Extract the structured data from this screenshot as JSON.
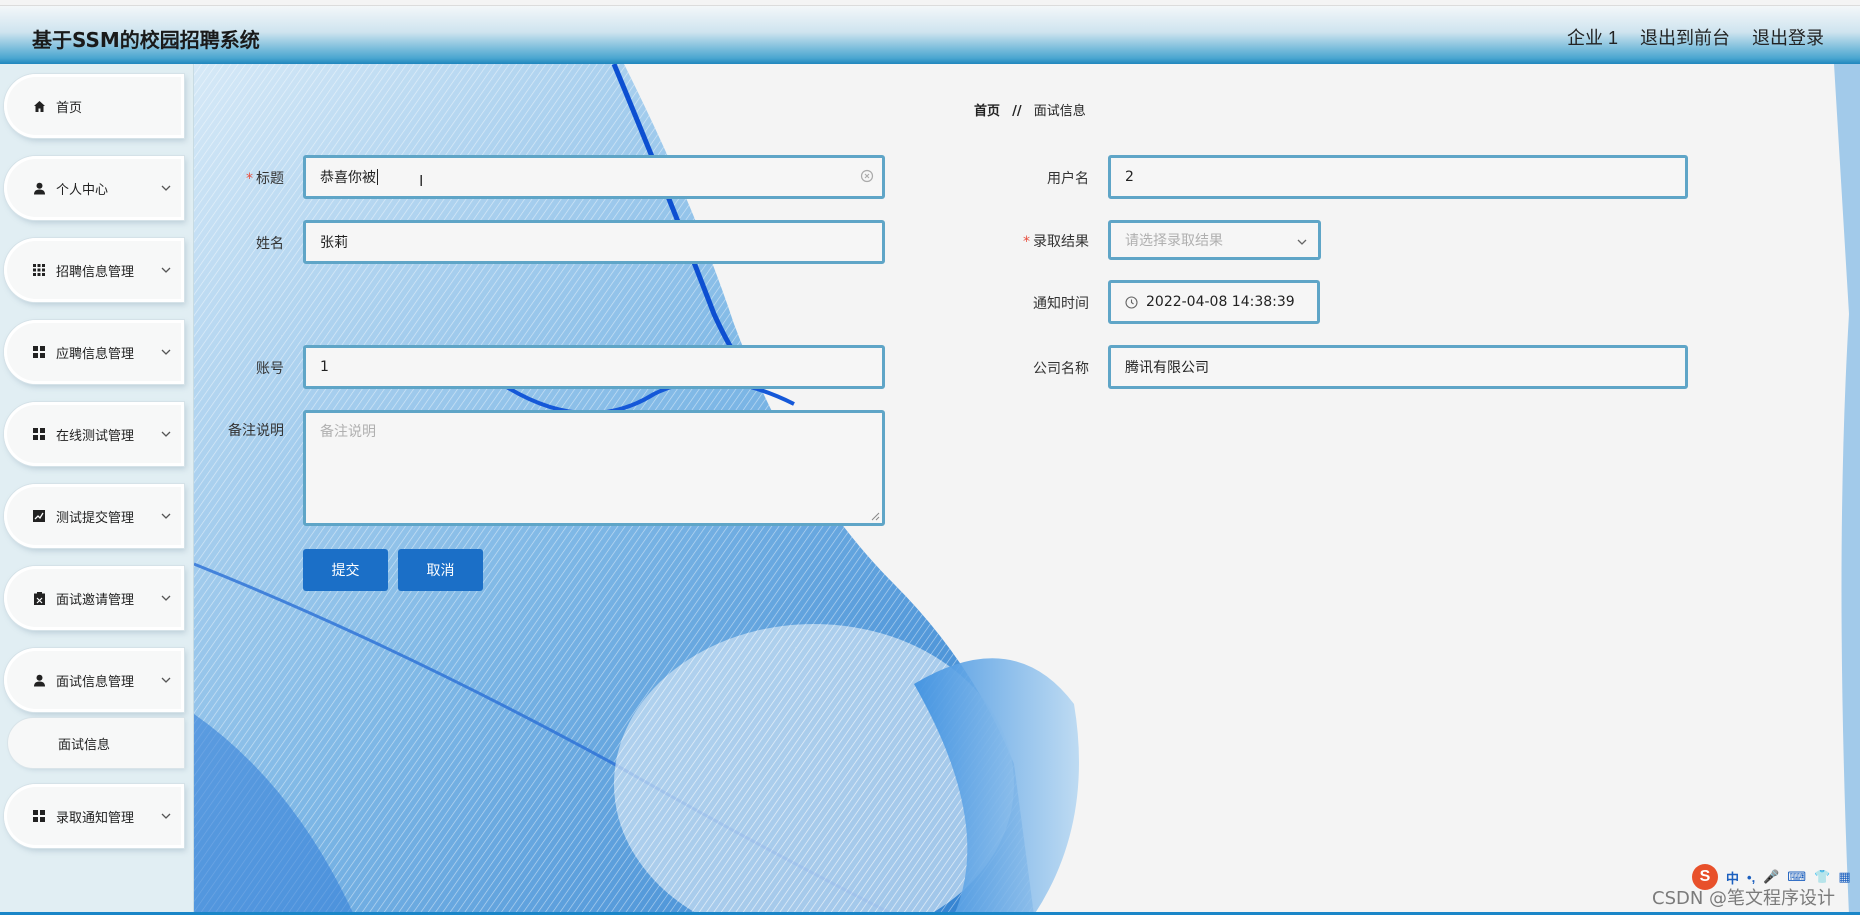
{
  "header": {
    "app_title": "基于SSM的校园招聘系统",
    "nav": [
      "企业 1",
      "退出到前台",
      "退出登录"
    ]
  },
  "sidebar": {
    "items": [
      {
        "label": "首页",
        "icon": "home-icon",
        "has_children": false
      },
      {
        "label": "个人中心",
        "icon": "user-icon",
        "has_children": true
      },
      {
        "label": "招聘信息管理",
        "icon": "grid-icon",
        "has_children": true
      },
      {
        "label": "应聘信息管理",
        "icon": "grid-icon",
        "has_children": true
      },
      {
        "label": "在线测试管理",
        "icon": "grid-icon",
        "has_children": true
      },
      {
        "label": "测试提交管理",
        "icon": "chart-icon",
        "has_children": true
      },
      {
        "label": "面试邀请管理",
        "icon": "clipboard-icon",
        "has_children": true
      },
      {
        "label": "面试信息管理",
        "icon": "user-icon",
        "has_children": true
      },
      {
        "label": "录取通知管理",
        "icon": "grid-icon",
        "has_children": true
      }
    ],
    "submenu": {
      "label": "面试信息"
    }
  },
  "breadcrumb": {
    "home": "首页",
    "separator": "//",
    "current": "面试信息"
  },
  "form": {
    "title": {
      "label": "标题",
      "required": true,
      "value": "恭喜你被"
    },
    "name": {
      "label": "姓名",
      "value": "张莉"
    },
    "account": {
      "label": "账号",
      "value": "1"
    },
    "remark": {
      "label": "备注说明",
      "placeholder": "备注说明"
    },
    "username": {
      "label": "用户名",
      "value": "2"
    },
    "result": {
      "label": "录取结果",
      "required": true,
      "placeholder": "请选择录取结果"
    },
    "notify_time": {
      "label": "通知时间",
      "value": "2022-04-08 14:38:39"
    },
    "company": {
      "label": "公司名称",
      "value": "腾讯有限公司"
    },
    "submit_label": "提交",
    "cancel_label": "取消"
  },
  "tray": {
    "ime_items": [
      "中",
      "•,",
      "🎤",
      "⌨",
      "👕",
      "▦"
    ]
  },
  "watermark": "CSDN @笔文程序设计",
  "colors": {
    "accent": "#1b6fc7",
    "field_border": "#5fa5c7",
    "required": "#e74c3c"
  }
}
